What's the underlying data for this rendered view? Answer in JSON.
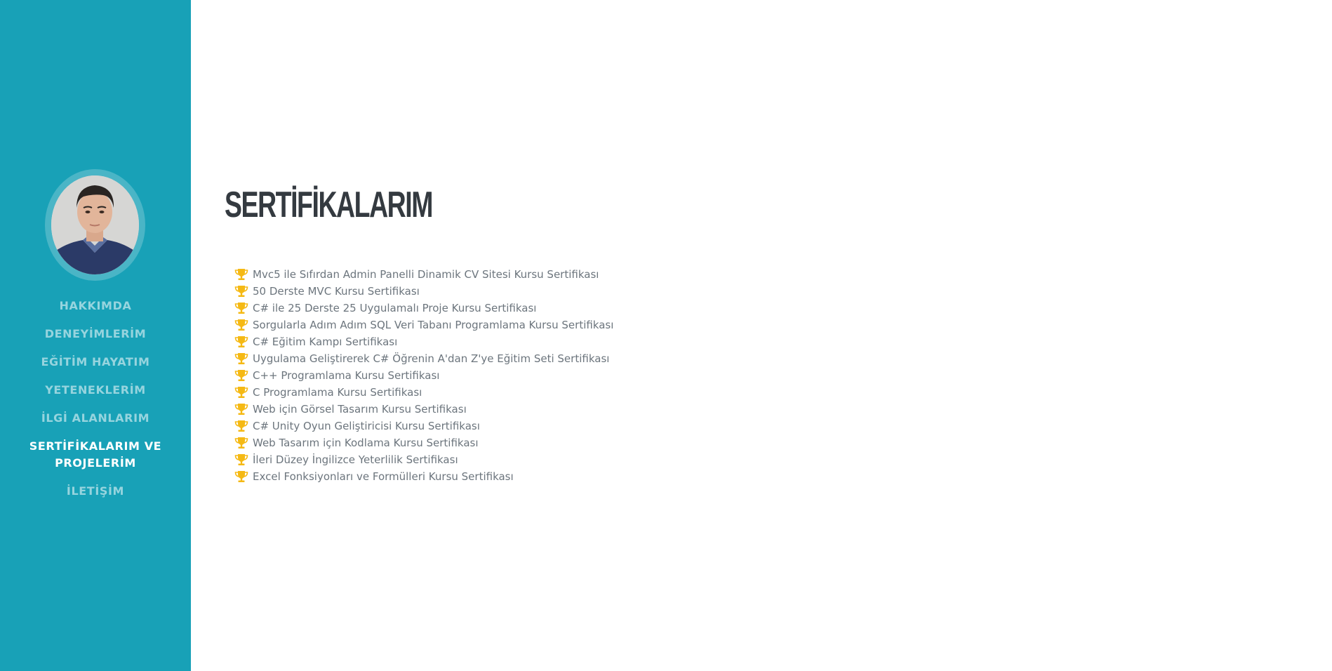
{
  "sidebar": {
    "bg_color": "#18a1b7",
    "nav": [
      {
        "label": "HAKKIMDA",
        "active": false
      },
      {
        "label": "DENEYİMLERİM",
        "active": false
      },
      {
        "label": "EĞİTİM HAYATIM",
        "active": false
      },
      {
        "label": "YETENEKLERİM",
        "active": false
      },
      {
        "label": "İLGİ ALANLARIM",
        "active": false
      },
      {
        "label": "SERTİFİKALARIM VE PROJELERİM",
        "active": true
      },
      {
        "label": "İLETİŞİM",
        "active": false
      }
    ]
  },
  "main": {
    "title": "SERTİFİKALARIM",
    "item_icon": "trophy-icon",
    "accent_color": "#f5b914",
    "certificates": [
      "Mvc5 ile Sıfırdan Admin Panelli Dinamik CV Sitesi Kursu Sertifikası",
      "50 Derste MVC Kursu Sertifikası",
      "C# ile 25 Derste 25 Uygulamalı Proje Kursu Sertifikası",
      "Sorgularla Adım Adım SQL Veri Tabanı Programlama Kursu Sertifikası",
      "C# Eğitim Kampı Sertifikası",
      "Uygulama Geliştirerek C# Öğrenin A'dan Z'ye Eğitim Seti Sertifikası",
      "C++ Programlama Kursu Sertifikası",
      "C Programlama Kursu Sertifikası",
      "Web için Görsel Tasarım Kursu Sertifikası",
      "C# Unity Oyun Geliştiricisi Kursu Sertifikası",
      "Web Tasarım için Kodlama Kursu Sertifikası",
      "İleri Düzey İngilizce Yeterlilik Sertifikası",
      "Excel Fonksiyonları ve Formülleri Kursu Sertifikası"
    ]
  }
}
